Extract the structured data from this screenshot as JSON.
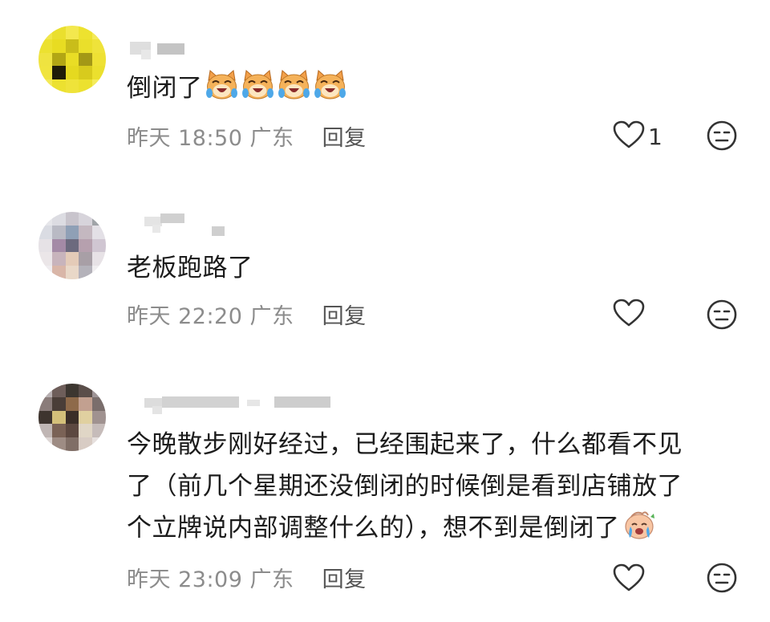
{
  "comments": [
    {
      "text": "倒闭了",
      "emoji_icon": "laughing-crying-cat-emoji",
      "emoji_count": 4,
      "date": "昨天 18:50",
      "location": "广东",
      "reply_label": "回复",
      "like_count": "1",
      "like_icon": "heart-outline-icon",
      "dislike_icon": "meh-face-icon"
    },
    {
      "text": "老板跑路了",
      "date": "昨天 22:20",
      "location": "广东",
      "reply_label": "回复",
      "like_count": "",
      "like_icon": "heart-outline-icon",
      "dislike_icon": "meh-face-icon"
    },
    {
      "text_line1": "今晚散步刚好经过，已经围起来了，什么都看不见",
      "text_line2": "了（前几个星期还没倒闭的时候倒是看到店铺放了",
      "text_line3": "个立牌说内部调整什么的），想不到是倒闭了",
      "emoji_icon": "crying-baby-emoji",
      "date": "昨天 23:09",
      "location": "广东",
      "reply_label": "回复",
      "like_count": "",
      "like_icon": "heart-outline-icon",
      "dislike_icon": "meh-face-icon"
    }
  ],
  "colors": {
    "meta_text": "#8c8c8c",
    "reply_text": "#555555",
    "body_text": "#1c1c1c"
  }
}
